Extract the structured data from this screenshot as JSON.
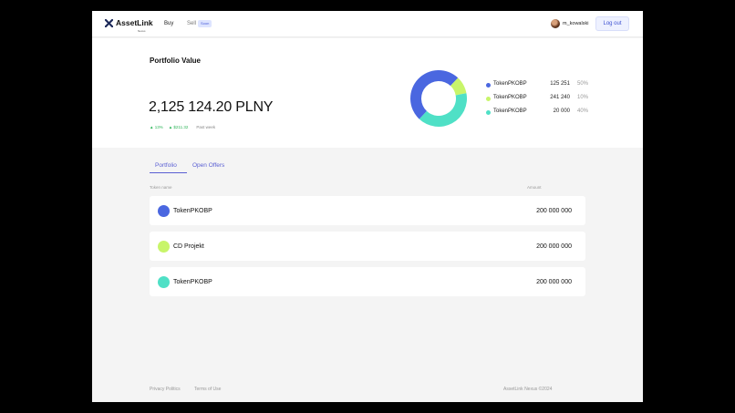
{
  "header": {
    "logo_text": "AssetLink",
    "logo_sub": "Nexus",
    "nav": {
      "buy_label": "Buy",
      "sell_label": "Sell",
      "soon_badge": "Soon"
    },
    "user": {
      "name": "m_kowalski"
    },
    "logout_label": "Log out"
  },
  "summary": {
    "title": "Portfolio Value",
    "amount": "2,125 124.20 PLNY",
    "change_pct": "▲ 13%",
    "change_value": "▲ $211.32",
    "period": "Past week"
  },
  "chart_data": {
    "type": "pie",
    "donut": true,
    "slices": [
      {
        "name": "TokenPKOBP",
        "value_label": "125 251",
        "percent": 50,
        "color": "#4a67e0"
      },
      {
        "name": "TokenPKOBP",
        "value_label": "241 240",
        "percent": 10,
        "color": "#c8f56a"
      },
      {
        "name": "TokenPKOBP",
        "value_label": "20 000",
        "percent": 40,
        "color": "#4fe0c6"
      }
    ],
    "legend": {
      "position": "right"
    }
  },
  "tabs": [
    {
      "label": "Portfolio",
      "active": true
    },
    {
      "label": "Open Offers",
      "active": false
    }
  ],
  "table": {
    "headers": {
      "name": "Token name",
      "amount": "Amount"
    },
    "rows": [
      {
        "name": "TokenPKOBP",
        "amount": "200 000 000",
        "color": "#4a67e0"
      },
      {
        "name": "CD Projekt",
        "amount": "200 000 000",
        "color": "#c8f56a"
      },
      {
        "name": "TokenPKOBP",
        "amount": "200 000 000",
        "color": "#4fe0c6"
      }
    ]
  },
  "footer": {
    "privacy": "Privacy Politics",
    "terms": "Terms of Use",
    "copyright": "AssetLink Nexus ©2024"
  }
}
